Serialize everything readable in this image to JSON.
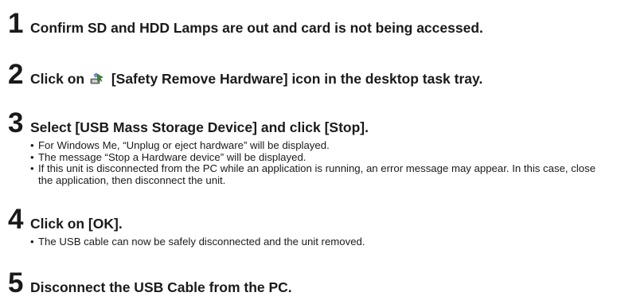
{
  "steps": [
    {
      "number": "1",
      "title": "Confirm SD and HDD Lamps are out and card is not being accessed.",
      "bullets": []
    },
    {
      "number": "2",
      "title_before_icon": "Click on",
      "icon": "safely-remove-hardware-icon",
      "title_after_icon": "[Safety Remove Hardware] icon in the desktop task tray.",
      "bullets": []
    },
    {
      "number": "3",
      "title": "Select [USB Mass Storage Device] and click [Stop].",
      "bullets": [
        "For Windows Me, “Unplug or eject hardware” will be displayed.",
        "The message “Stop a Hardware device” will be displayed.",
        "If this unit is disconnected from the PC while an application is running, an error message may appear. In this case, close the application, then disconnect the unit."
      ]
    },
    {
      "number": "4",
      "title": "Click on [OK].",
      "bullets": [
        "The USB cable can now be safely disconnected and the unit removed."
      ]
    },
    {
      "number": "5",
      "title": "Disconnect the USB Cable from the PC.",
      "bullets": []
    }
  ]
}
